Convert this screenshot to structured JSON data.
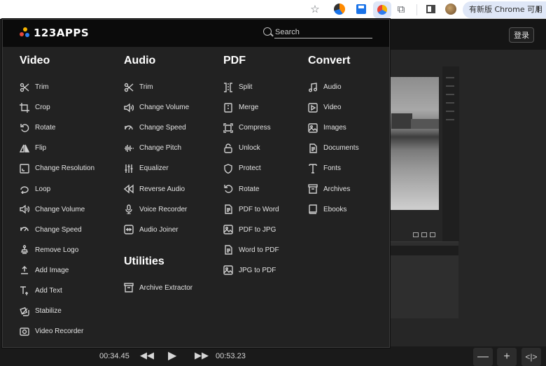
{
  "browser": {
    "update_button": "有新版 Chrome 可用",
    "star_icon": "star-icon"
  },
  "menu": {
    "logo_text": "123APPS",
    "search": {
      "placeholder": "Search",
      "value": ""
    },
    "columns": {
      "video": {
        "title": "Video",
        "items": [
          {
            "label": "Trim",
            "icon": "scissors-icon"
          },
          {
            "label": "Crop",
            "icon": "crop-icon"
          },
          {
            "label": "Rotate",
            "icon": "rotate-icon"
          },
          {
            "label": "Flip",
            "icon": "flip-icon"
          },
          {
            "label": "Change Resolution",
            "icon": "resolution-icon"
          },
          {
            "label": "Loop",
            "icon": "loop-icon"
          },
          {
            "label": "Change Volume",
            "icon": "volume-icon"
          },
          {
            "label": "Change Speed",
            "icon": "speed-icon"
          },
          {
            "label": "Remove Logo",
            "icon": "stamp-icon"
          },
          {
            "label": "Add Image",
            "icon": "add-image-icon"
          },
          {
            "label": "Add Text",
            "icon": "add-text-icon"
          },
          {
            "label": "Stabilize",
            "icon": "stabilize-icon"
          },
          {
            "label": "Video Recorder",
            "icon": "record-icon"
          }
        ]
      },
      "audio": {
        "title": "Audio",
        "items": [
          {
            "label": "Trim",
            "icon": "scissors-icon"
          },
          {
            "label": "Change Volume",
            "icon": "volume-icon"
          },
          {
            "label": "Change Speed",
            "icon": "speed-icon"
          },
          {
            "label": "Change Pitch",
            "icon": "pitch-icon"
          },
          {
            "label": "Equalizer",
            "icon": "equalizer-icon"
          },
          {
            "label": "Reverse Audio",
            "icon": "reverse-icon"
          },
          {
            "label": "Voice Recorder",
            "icon": "microphone-icon"
          },
          {
            "label": "Audio Joiner",
            "icon": "joiner-icon"
          }
        ]
      },
      "utilities": {
        "title": "Utilities",
        "items": [
          {
            "label": "Archive Extractor",
            "icon": "archive-icon"
          }
        ]
      },
      "pdf": {
        "title": "PDF",
        "items": [
          {
            "label": "Split",
            "icon": "split-icon"
          },
          {
            "label": "Merge",
            "icon": "merge-icon"
          },
          {
            "label": "Compress",
            "icon": "compress-icon"
          },
          {
            "label": "Unlock",
            "icon": "unlock-icon"
          },
          {
            "label": "Protect",
            "icon": "shield-icon"
          },
          {
            "label": "Rotate",
            "icon": "rotate-icon"
          },
          {
            "label": "PDF to Word",
            "icon": "document-icon"
          },
          {
            "label": "PDF to JPG",
            "icon": "image-icon"
          },
          {
            "label": "Word to PDF",
            "icon": "document-icon"
          },
          {
            "label": "JPG to PDF",
            "icon": "image-icon"
          }
        ]
      },
      "convert": {
        "title": "Convert",
        "items": [
          {
            "label": "Audio",
            "icon": "music-note-icon"
          },
          {
            "label": "Video",
            "icon": "video-icon"
          },
          {
            "label": "Images",
            "icon": "image-icon"
          },
          {
            "label": "Documents",
            "icon": "document-icon"
          },
          {
            "label": "Fonts",
            "icon": "font-icon"
          },
          {
            "label": "Archives",
            "icon": "archive-icon"
          },
          {
            "label": "Ebooks",
            "icon": "book-icon"
          }
        ]
      }
    }
  },
  "editor": {
    "login_label": "登录",
    "time_current": "00:34.45",
    "time_total": "00:53.23"
  }
}
